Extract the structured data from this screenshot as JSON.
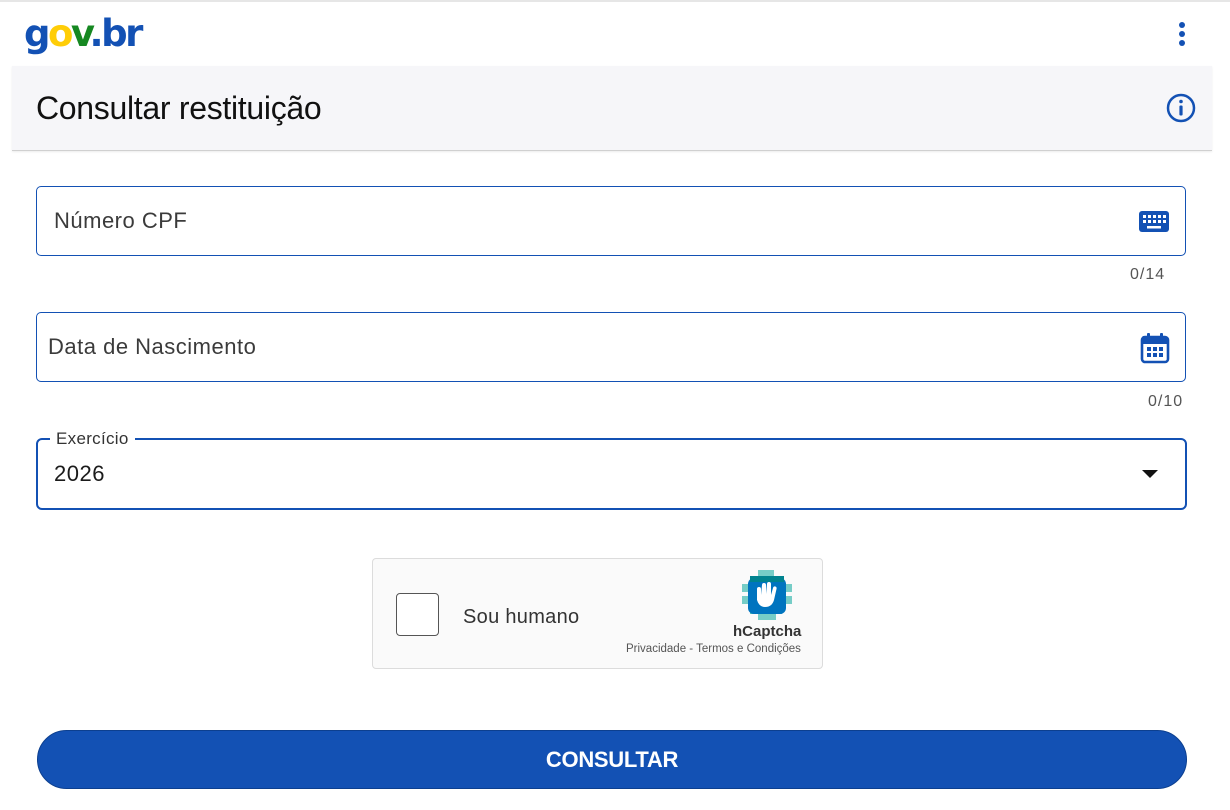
{
  "header": {
    "logo": {
      "g": "g",
      "o": "o",
      "v": "v",
      "dot": ".",
      "b": "b",
      "r": "r"
    },
    "menu_icon": "kebab-vertical-icon"
  },
  "page": {
    "title": "Consultar restituição",
    "info_icon": "info-circle-icon"
  },
  "form": {
    "cpf": {
      "placeholder": "Número CPF",
      "counter": "0/14",
      "icon": "keyboard-icon"
    },
    "birthdate": {
      "placeholder": "Data de Nascimento",
      "counter": "0/10",
      "icon": "calendar-icon"
    },
    "exercicio": {
      "label": "Exercício",
      "value": "2026"
    }
  },
  "captcha": {
    "label": "Sou humano",
    "brand": "hCaptcha",
    "privacy": "Privacidade",
    "separator": " - ",
    "terms": "Termos e Condições"
  },
  "submit": {
    "label": "CONSULTAR"
  },
  "colors": {
    "primary": "#1351b4",
    "logo_yellow": "#ffcd07",
    "logo_green": "#168821",
    "titlebar_bg": "#f6f6f9"
  }
}
